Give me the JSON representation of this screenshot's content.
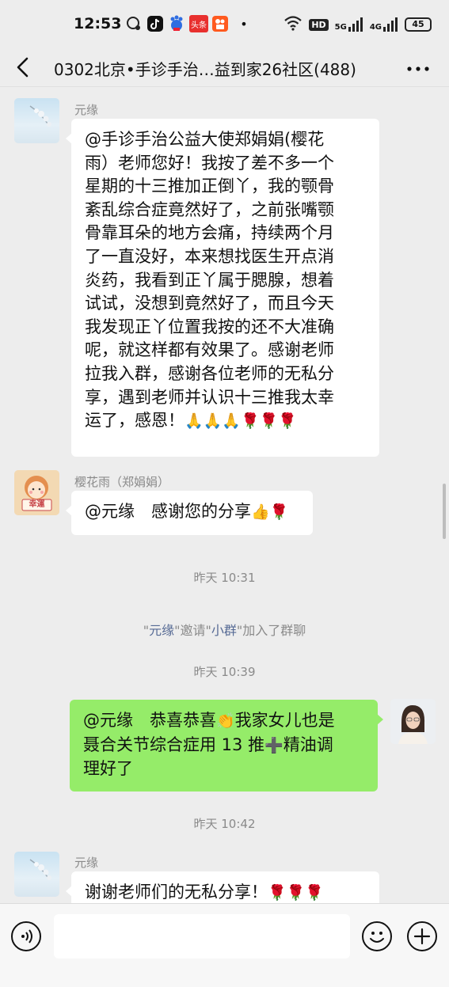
{
  "status_bar": {
    "time": "12:53",
    "notification_icons": [
      "chat-bubble-icon",
      "tiktok-icon",
      "baidu-icon",
      "toutiao-icon",
      "kuaishou-icon"
    ],
    "toutiao_label": "头条",
    "dot": "•",
    "hd_label": "HD",
    "net5g": "5G",
    "net4g": "4G",
    "battery": "45"
  },
  "header": {
    "title": "0302北京•手诊手治…益到家26社区(488)",
    "more_label": "···"
  },
  "messages": [
    {
      "sender": "元缘",
      "lines": [
        "@手诊手治公益大使郑娟娟(樱花",
        "雨）老师您好！我按了差不多一个",
        "星期的十三推加正倒丫，我的颚骨",
        "紊乱综合症竟然好了，之前张嘴颚",
        "骨靠耳朵的地方会痛，持续两个月",
        "了一直没好，本来想找医生开点消",
        "炎药，我看到正丫属于腮腺，想着",
        "试试，没想到竟然好了，而且今天",
        "我发现正丫位置我按的还不大准确",
        "呢，就这样都有效果了。感谢老师",
        "拉我入群，感谢各位老师的无私分",
        "享，遇到老师并认识十三推我太幸"
      ],
      "last_line": "运了，感恩！",
      "emojis": "🙏🙏🙏🌹🌹🌹"
    },
    {
      "sender": "樱花雨（郑娟娟）",
      "avatar_text": "幸運",
      "text": "@元缘　感谢您的分享",
      "emojis": "👍🌹"
    },
    {
      "text_a": "@元缘　恭喜恭喜",
      "emoji_a": "👏",
      "text_b": "我家女儿也是",
      "line2_a": "聂合关节综合症用 13 推",
      "emoji_b": "➕",
      "line2_b": "精油调",
      "line3": "理好了"
    },
    {
      "sender": "元缘",
      "text": "谢谢老师们的无私分享！",
      "emojis": "🌹🌹🌹"
    }
  ],
  "timestamps": [
    "昨天 10:31",
    "昨天 10:39",
    "昨天 10:42"
  ],
  "system_notice": {
    "q1": "\"",
    "inviter": "元缘",
    "q2": "\"邀请\"",
    "invitee": "小群",
    "suffix": "\"加入了群聊"
  },
  "input": {
    "placeholder": ""
  },
  "colors": {
    "background": "#ededed",
    "bubble_self": "#95ec69",
    "bubble_other": "#ffffff",
    "link": "#576b95"
  }
}
